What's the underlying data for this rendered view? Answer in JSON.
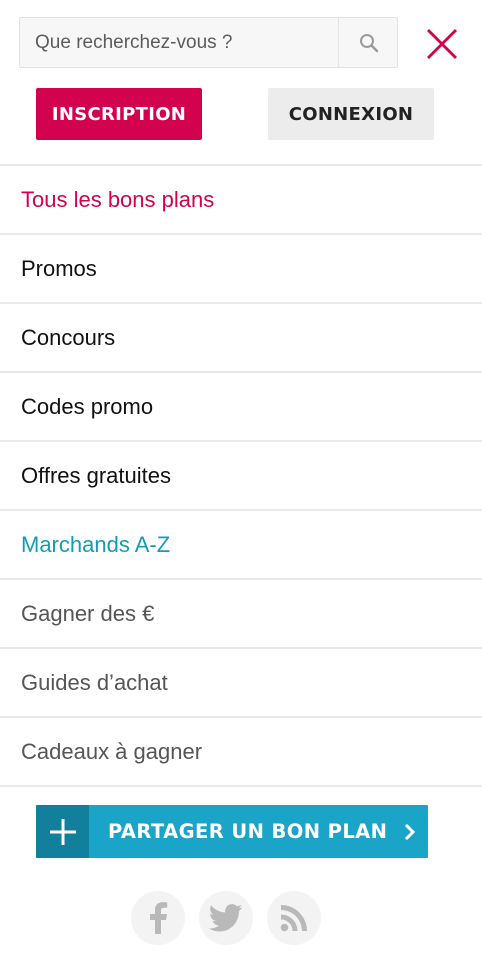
{
  "search": {
    "placeholder": "Que recherchez-vous ?",
    "value": ""
  },
  "auth": {
    "signup_label": "INSCRIPTION",
    "login_label": "CONNEXION"
  },
  "menu": {
    "items": [
      {
        "label": "Tous les bons plans"
      },
      {
        "label": "Promos"
      },
      {
        "label": "Concours"
      },
      {
        "label": "Codes promo"
      },
      {
        "label": "Offres gratuites"
      },
      {
        "label": "Marchands A-Z"
      },
      {
        "label": "Gagner des €"
      },
      {
        "label": "Guides d’achat"
      },
      {
        "label": "Cadeaux à gagner"
      }
    ]
  },
  "share": {
    "label": "PARTAGER UN BON PLAN"
  },
  "social": {
    "icons": [
      "facebook-icon",
      "twitter-icon",
      "rss-icon"
    ]
  },
  "colors": {
    "primary": "#d2024f",
    "accent": "#1aa5c8",
    "accent_dark": "#127f9d",
    "teal_link": "#139bb8"
  }
}
